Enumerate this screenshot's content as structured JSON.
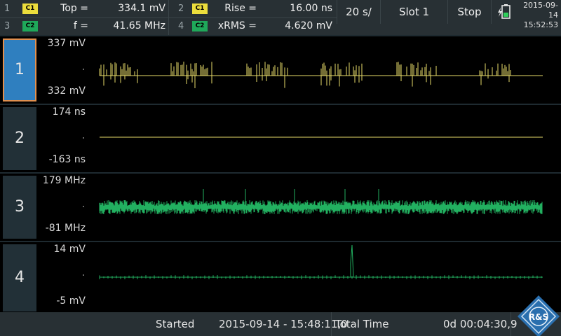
{
  "measurements": [
    {
      "index": "1",
      "chip": "C1",
      "name": "Top =",
      "value": "334.1 mV"
    },
    {
      "index": "2",
      "chip": "C1",
      "name": "Rise =",
      "value": "16.00 ns"
    },
    {
      "index": "3",
      "chip": "C2",
      "name": "f =",
      "value": "41.65 MHz"
    },
    {
      "index": "4",
      "chip": "C2",
      "name": "xRMS =",
      "value": "4.620 mV"
    }
  ],
  "toolbar": {
    "timebase": "20 s/",
    "slot": "Slot 1",
    "run_state": "Stop",
    "date": "2015-09-14",
    "time": "15:52:53"
  },
  "panels": [
    {
      "label": "1",
      "top": "337 mV",
      "bottom": "332 mV",
      "color": "#e8dc6a"
    },
    {
      "label": "2",
      "top": "174 ns",
      "bottom": "-163 ns",
      "color": "#e8dc6a"
    },
    {
      "label": "3",
      "top": "179 MHz",
      "bottom": "-81 MHz",
      "color": "#22b060"
    },
    {
      "label": "4",
      "top": "14 mV",
      "bottom": "-5 mV",
      "color": "#22b060"
    }
  ],
  "status": {
    "started_label": "Started",
    "started_value": "2015-09-14 - 15:48:11,0",
    "total_label": "Total Time",
    "total_value": "0d 00:04:30,9"
  },
  "logo_text": "R&S",
  "colors": {
    "chip_c1": "#ecdd3c",
    "chip_c2": "#1fa85a",
    "active_panel": "#2f7fbf"
  }
}
